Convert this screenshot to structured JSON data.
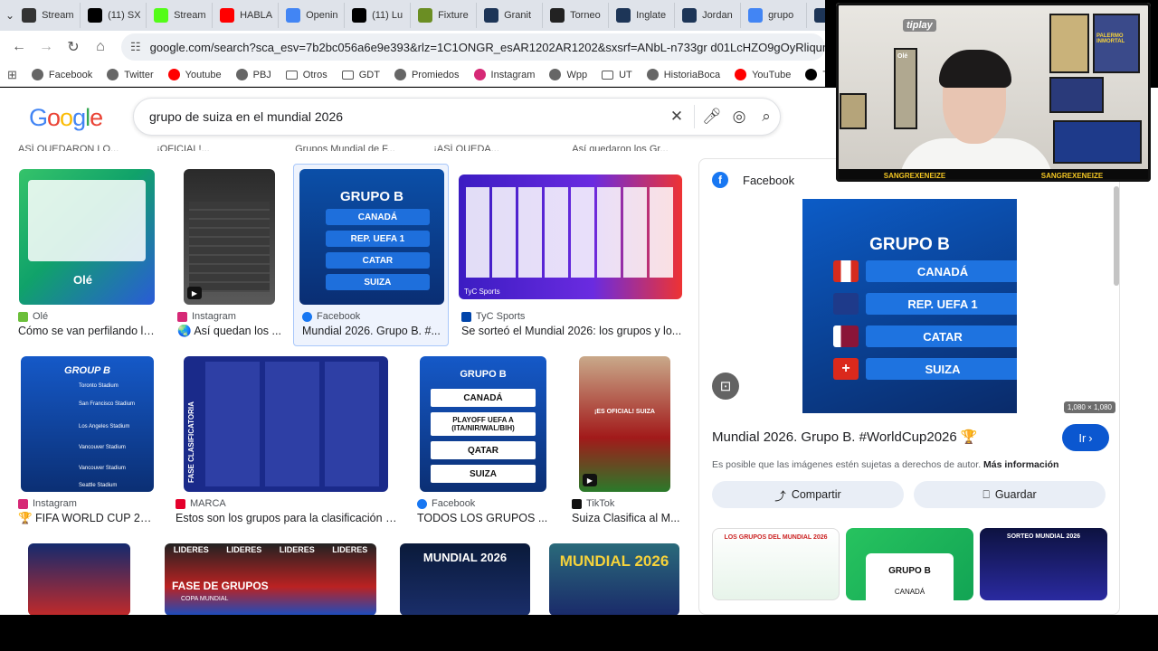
{
  "tabs": [
    {
      "label": "Stream",
      "icon": "dotabuff-icon",
      "color": "#333"
    },
    {
      "label": "(11) SX",
      "icon": "x-icon",
      "color": "#000"
    },
    {
      "label": "Stream",
      "icon": "kick-icon",
      "color": "#53fc18"
    },
    {
      "label": "HABLA",
      "icon": "youtube-icon",
      "color": "#ff0000"
    },
    {
      "label": "Openin",
      "icon": "google-icon",
      "color": "#4285f4"
    },
    {
      "label": "(11) Lu",
      "icon": "x-icon",
      "color": "#000"
    },
    {
      "label": "Fixture",
      "icon": "globe-icon",
      "color": "#6b8e23"
    },
    {
      "label": "Granit",
      "icon": "fm-icon",
      "color": "#1d3557"
    },
    {
      "label": "Torneo",
      "icon": "tournament-icon",
      "color": "#222"
    },
    {
      "label": "Inglate",
      "icon": "fm-icon",
      "color": "#1d3557"
    },
    {
      "label": "Jordan",
      "icon": "fm-icon",
      "color": "#1d3557"
    },
    {
      "label": "grupo",
      "icon": "google-icon",
      "color": "#4285f4"
    },
    {
      "label": "",
      "icon": "fm-icon",
      "color": "#1d3557"
    }
  ],
  "address": {
    "url": "google.com/search?sca_esv=7b2bc056a6e9e393&rlz=1C1ONGR_esAR1202AR1202&sxsrf=ANbL-n733gr d01LcHZO9gOyRliqum5h9oA:1774816062"
  },
  "bookmarks": [
    {
      "label": "Facebook",
      "type": "site"
    },
    {
      "label": "Twitter",
      "type": "site"
    },
    {
      "label": "Youtube",
      "type": "youtube"
    },
    {
      "label": "PBJ",
      "type": "site"
    },
    {
      "label": "Otros",
      "type": "folder"
    },
    {
      "label": "GDT",
      "type": "folder"
    },
    {
      "label": "Promiedos",
      "type": "site"
    },
    {
      "label": "Instagram",
      "type": "instagram"
    },
    {
      "label": "Wpp",
      "type": "site"
    },
    {
      "label": "UT",
      "type": "folder"
    },
    {
      "label": "HistoriaBoca",
      "type": "site"
    },
    {
      "label": "YouTube",
      "type": "youtube"
    },
    {
      "label": "Twitter",
      "type": "x"
    },
    {
      "label": "",
      "type": "folder"
    }
  ],
  "search": {
    "logo": "Google",
    "query": "grupo de suiza en el mundial 2026"
  },
  "strip_captions": [
    "ASÍ QUEDARON LO...",
    "¡OFICIAL!...",
    "Grupos Mundial de F...",
    "¡ASÍ QUEDA...",
    "Así quedaron los Gr..."
  ],
  "results_row1": [
    {
      "source": "Olé",
      "title": "Cómo se van perfilando lo...",
      "src_color": "#6bbf3a"
    },
    {
      "source": "Instagram",
      "title": "🌏 Así quedan los ...",
      "src_color": "#d62976"
    },
    {
      "source": "Facebook",
      "title": "Mundial 2026. Grupo B. #...",
      "src_color": "#1877f2"
    },
    {
      "source": "TyC Sports",
      "title": "Se sorteó el Mundial 2026: los grupos y lo...",
      "src_color": "#0044aa"
    }
  ],
  "results_row2": [
    {
      "source": "Instagram",
      "title": "🏆 FIFA WORLD CUP 20...",
      "src_color": "#d62976"
    },
    {
      "source": "MARCA",
      "title": "Estos son los grupos para la clasificación d...",
      "src_color": "#e4002b"
    },
    {
      "source": "Facebook",
      "title": "TODOS LOS GRUPOS ...",
      "src_color": "#1877f2"
    },
    {
      "source": "TikTok",
      "title": "Suiza Clasifica al M...",
      "src_color": "#111"
    }
  ],
  "thumb_text": {
    "grupo_b": "GRUPO B",
    "canada": "CANADÁ",
    "rep_uefa": "REP. UEFA 1",
    "catar": "CATAR",
    "suiza": "SUIZA",
    "group_b_alt": "GROUP B",
    "toronto": "Toronto Stadium",
    "sf": "San Francisco Stadium",
    "la": "Los Angeles Stadium",
    "vancouver": "Vancouver Stadium",
    "vancouver2": "Vancouver Stadium",
    "seattle": "Seattle Stadium",
    "fase": "FASE CLASIFICATORIA",
    "playoff": "PLAYOFF UEFA A (ITA/NIR/WAL/BIH)",
    "qatar": "QATAR",
    "suiza2": "SUIZA",
    "canada2": "CANADÁ",
    "oficial": "¡ES OFICIAL! SUIZA",
    "fase_grupos": "FASE DE GRUPOS",
    "copa_mundial": "COPA MUNDIAL",
    "lideres": "LIDERES",
    "mundial_2026": "MUNDIAL 2026",
    "mundial_2026b": "MUNDIAL 2026",
    "tyc": "TyC Sports"
  },
  "panel": {
    "source": "Facebook",
    "title": "Mundial 2026. Grupo B. #WorldCup2026 🏆",
    "go_label": "Ir",
    "rights_text": "Es posible que las imágenes estén sujetas a derechos de autor.",
    "more_info": "Más información",
    "share_label": "Compartir",
    "save_label": "Guardar",
    "dimensions": "1,080 × 1,080",
    "image_title": "GRUPO B",
    "rows": [
      "CANADÁ",
      "REP. UEFA 1",
      "CATAR",
      "SUIZA"
    ],
    "related_1": "LOS GRUPOS DEL MUNDIAL 2026",
    "related_2": "GRUPO B",
    "related_2_row": "CANADÁ",
    "related_3": "SORTEO MUNDIAL 2026"
  },
  "webcam": {
    "brand": "tiplay",
    "handle_left": "SANGREXENEIZE",
    "handle_right": "SANGREXENEIZE",
    "poster_1": "PALERMO INMORTAL",
    "poster_2": "Olé"
  },
  "colors": {
    "accent": "#0b57d0",
    "facebook": "#1877f2",
    "canada_red": "#d52b1e",
    "swiss_red": "#da291c",
    "qatar_maroon": "#8a1538"
  }
}
